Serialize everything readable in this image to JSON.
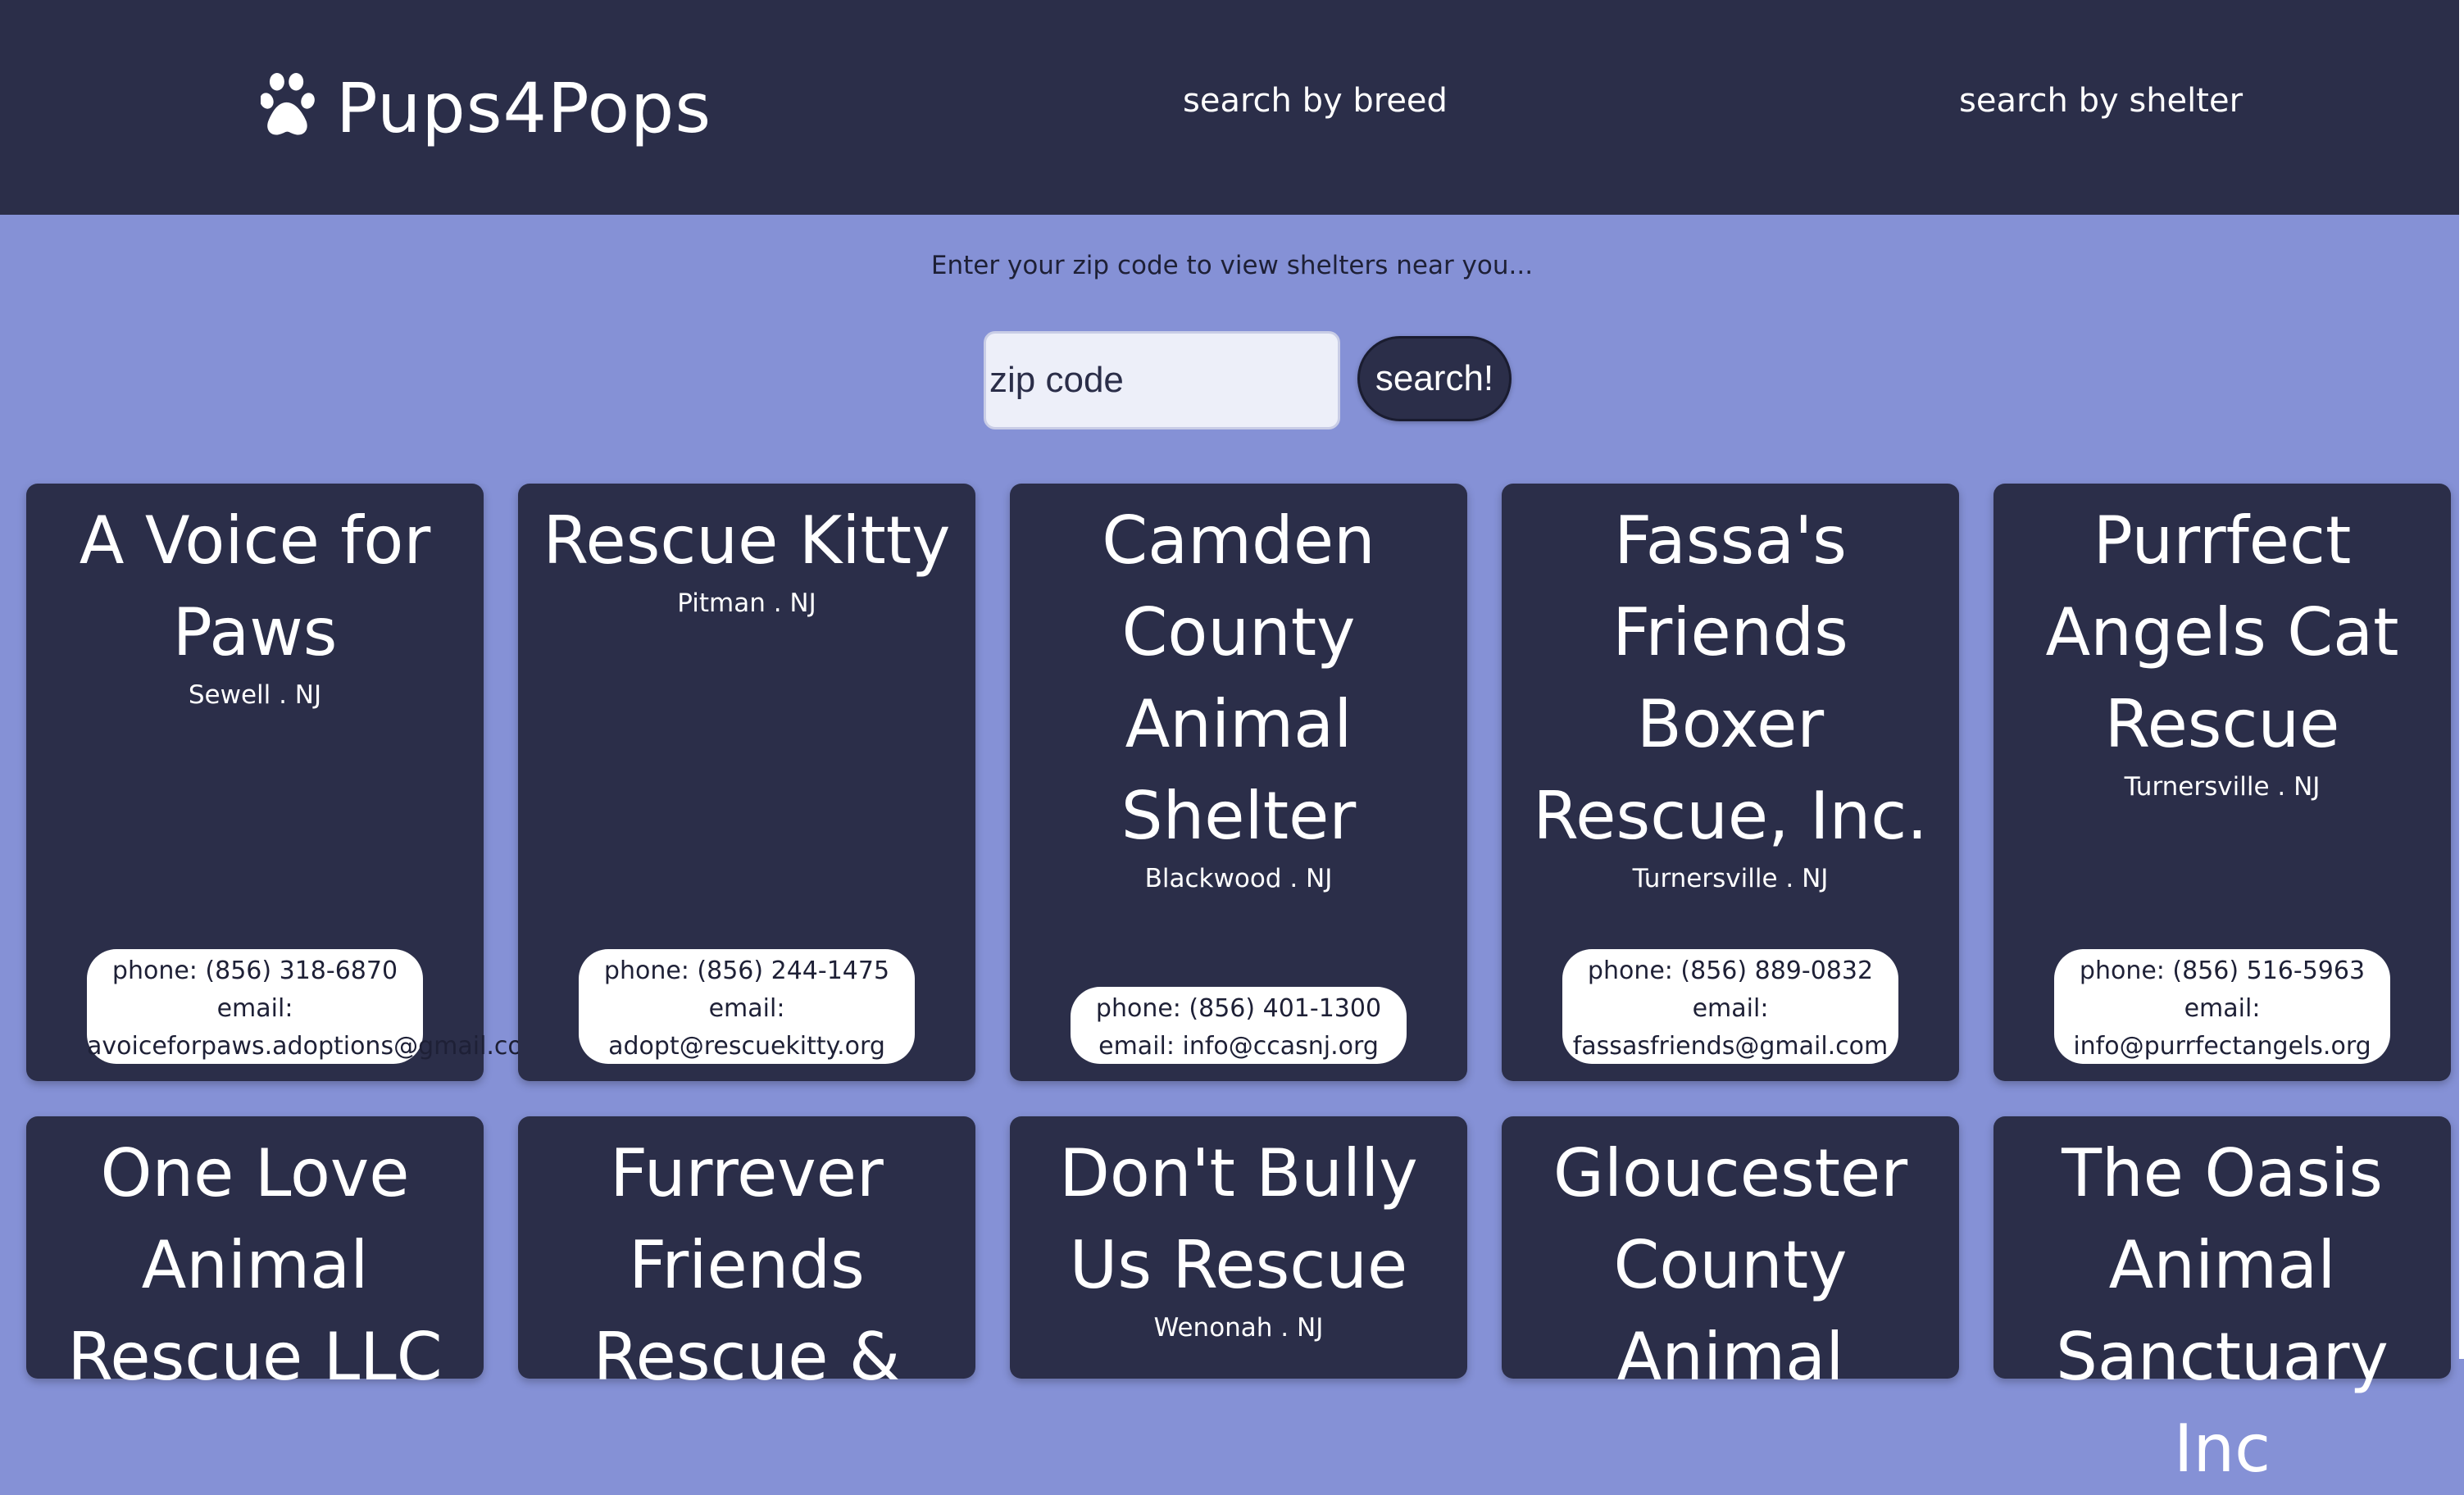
{
  "nav": {
    "logo_text": "Pups4Pops",
    "breed_link": "search by breed",
    "shelter_link": "search by shelter"
  },
  "search": {
    "prompt": "Enter your zip code to view shelters near you...",
    "placeholder": "zip code",
    "value": "",
    "button_label": "search!"
  },
  "shelters": [
    {
      "name": "A Voice for Paws",
      "location": "Sewell . NJ",
      "phone": "phone: (856) 318-6870",
      "email_label": "email:",
      "email": "avoiceforpaws.adoptions@gmail.com"
    },
    {
      "name": "Rescue Kitty",
      "location": "Pitman . NJ",
      "phone": "phone: (856) 244-1475",
      "email_label": "email:",
      "email": "adopt@rescuekitty.org"
    },
    {
      "name": "Camden County Animal Shelter",
      "location": "Blackwood . NJ",
      "phone": "phone: (856) 401-1300",
      "email_line": "email: info@ccasnj.org"
    },
    {
      "name": "Fassa's Friends Boxer Rescue, Inc.",
      "location": "Turnersville . NJ",
      "phone": "phone: (856) 889-0832",
      "email_label": "email:",
      "email": "fassasfriends@gmail.com"
    },
    {
      "name": "Purrfect Angels Cat Rescue",
      "location": "Turnersville . NJ",
      "phone": "phone: (856) 516-5963",
      "email_label": "email:",
      "email": "info@purrfectangels.org"
    },
    {
      "name": "One Love Animal Rescue LLC"
    },
    {
      "name": "Furrever Friends Rescue &"
    },
    {
      "name": "Don't Bully Us Rescue",
      "location": "Wenonah . NJ"
    },
    {
      "name": "Gloucester County Animal"
    },
    {
      "name": "The Oasis Animal Sanctuary Inc"
    }
  ]
}
